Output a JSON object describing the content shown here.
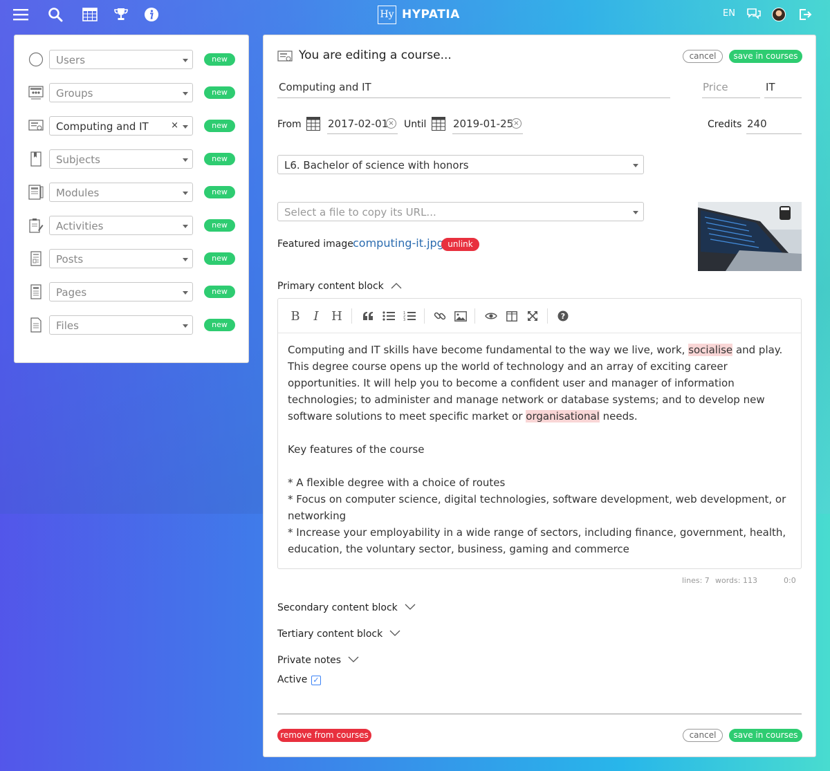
{
  "brand": {
    "mark": "Hy",
    "name": "HYPATIA"
  },
  "topbar": {
    "lang": "EN"
  },
  "sidebar": {
    "items": [
      {
        "value": "Users",
        "filled": false,
        "badge": "new",
        "icon": "users-icon"
      },
      {
        "value": "Groups",
        "filled": false,
        "badge": "new",
        "icon": "groups-icon"
      },
      {
        "value": "Computing and IT",
        "filled": true,
        "clear": "×",
        "badge": "new",
        "icon": "courses-icon"
      },
      {
        "value": "Subjects",
        "filled": false,
        "badge": "new",
        "icon": "subjects-icon"
      },
      {
        "value": "Modules",
        "filled": false,
        "badge": "new",
        "icon": "modules-icon"
      },
      {
        "value": "Activities",
        "filled": false,
        "badge": "new",
        "icon": "activities-icon"
      },
      {
        "value": "Posts",
        "filled": false,
        "badge": "new",
        "icon": "posts-icon"
      },
      {
        "value": "Pages",
        "filled": false,
        "badge": "new",
        "icon": "pages-icon"
      },
      {
        "value": "Files",
        "filled": false,
        "badge": "new",
        "icon": "files-icon"
      }
    ]
  },
  "editor": {
    "heading": "You are editing a course...",
    "cancel": "cancel",
    "save": "save in courses",
    "remove": "remove from courses",
    "course_name": "Computing and IT",
    "price_placeholder": "Price",
    "price_code": "IT",
    "from_label": "From",
    "from_date": "2017-02-01",
    "until_label": "Until",
    "until_date": "2019-01-25",
    "credits_label": "Credits",
    "credits_value": "240",
    "level": "L6. Bachelor of science with honors",
    "file_placeholder": "Select a file to copy its URL...",
    "featured_label": "Featured image",
    "featured_file": "computing-it.jpg",
    "unlink": "unlink",
    "primary_label": "Primary content block",
    "secondary_label": "Secondary content block",
    "tertiary_label": "Tertiary content block",
    "private_label": "Private notes",
    "active_label": "Active",
    "active_mark": "✓",
    "content": {
      "p1_a": "Computing and IT skills have become fundamental to the way we live, work, ",
      "p1_hl1": "socialise",
      "p1_b": " and play. This degree course opens up the world of technology and an array of exciting career opportunities. It will help you to become a confident user and manager of information technologies; to administer and manage network or database systems; and to develop new software solutions to meet specific market or ",
      "p1_hl2": "organisational",
      "p1_c": " needs.",
      "p2": "Key features of the course",
      "li1": "* A flexible degree with a choice of routes",
      "li2": "* Focus on computer science, digital technologies, software development, web development, or networking",
      "li3": "* Increase your employability in a wide range of sectors, including finance, government, health, education, the voluntary sector, business, gaming and commerce"
    },
    "status": {
      "lines": "lines: 7",
      "words": "words: 113",
      "cursor": "0:0"
    },
    "toolbar": {
      "bold": "B",
      "italic": "I",
      "heading": "H"
    }
  },
  "colors": {
    "accent_green": "#2ecc71",
    "danger_red": "#e8303e",
    "checkbox_blue": "#3b82f6"
  }
}
